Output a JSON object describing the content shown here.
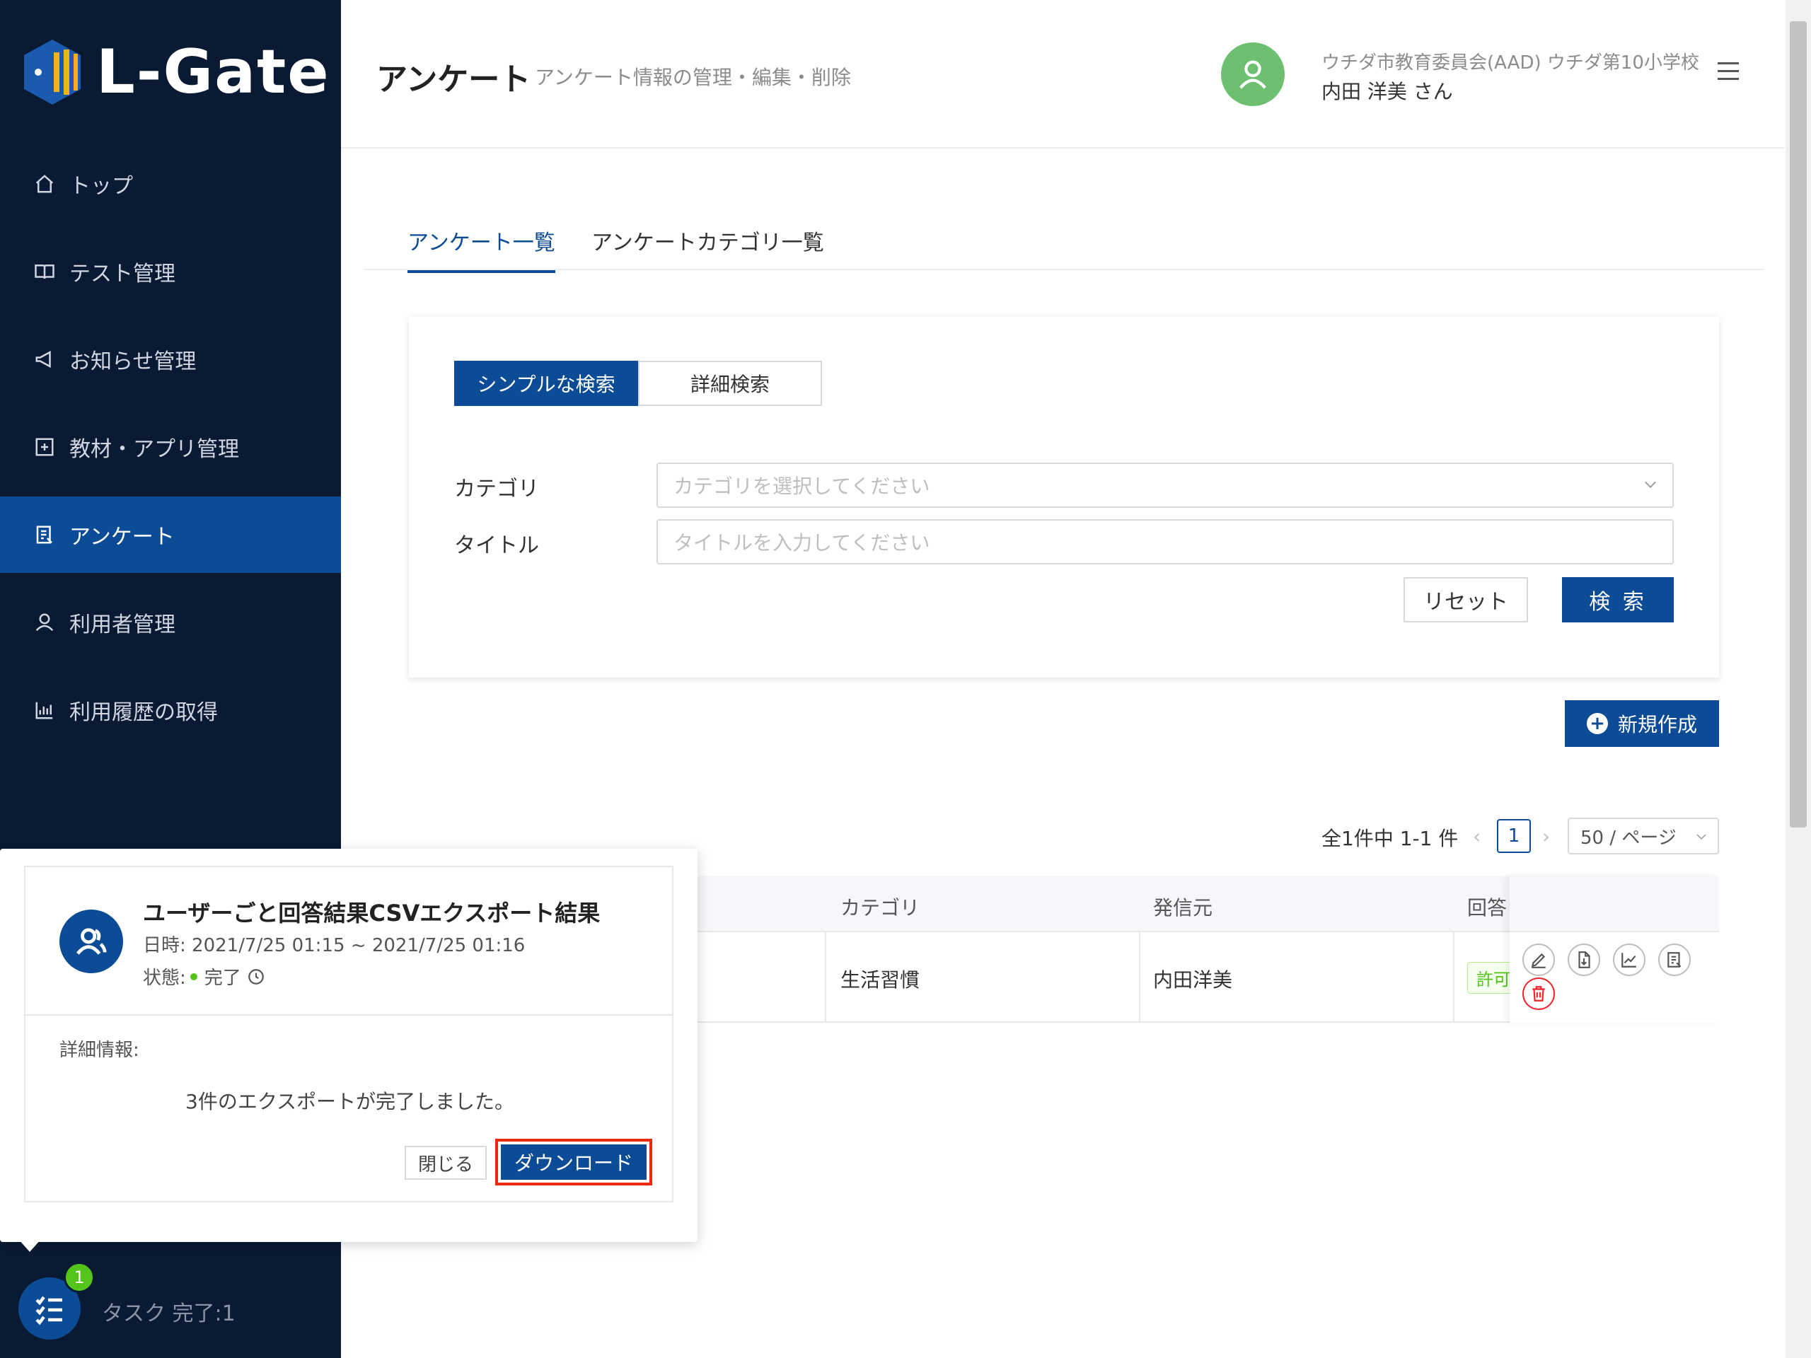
{
  "brand": {
    "name": "L-Gate"
  },
  "sidebar": {
    "items": [
      {
        "label": "トップ",
        "icon": "home-icon"
      },
      {
        "label": "テスト管理",
        "icon": "book-icon"
      },
      {
        "label": "お知らせ管理",
        "icon": "megaphone-icon"
      },
      {
        "label": "教材・アプリ管理",
        "icon": "plus-square-icon"
      },
      {
        "label": "アンケート",
        "icon": "survey-icon",
        "active": true
      },
      {
        "label": "利用者管理",
        "icon": "user-icon"
      },
      {
        "label": "利用履歴の取得",
        "icon": "bar-chart-icon"
      }
    ],
    "task": {
      "badge": "1",
      "label": "タスク 完了:1"
    }
  },
  "header": {
    "title": "アンケート",
    "subtitle": "アンケート情報の管理・編集・削除",
    "org": "ウチダ市教育委員会(AAD)   ウチダ第10小学校",
    "user": "内田 洋美 さん"
  },
  "tabs": [
    {
      "label": "アンケート一覧",
      "active": true
    },
    {
      "label": "アンケートカテゴリ一覧"
    }
  ],
  "search": {
    "mode_simple": "シンプルな検索",
    "mode_detail": "詳細検索",
    "category_label": "カテゴリ",
    "category_placeholder": "カテゴリを選択してください",
    "title_label": "タイトル",
    "title_placeholder": "タイトルを入力してください",
    "reset": "リセット",
    "submit": "検 索"
  },
  "new_button": "新規作成",
  "pagination": {
    "total": "全1件中 1-1 件",
    "current": "1",
    "page_size": "50 / ページ"
  },
  "table": {
    "headers": {
      "category": "カテゴリ",
      "sender": "発信元",
      "answer": "回答"
    },
    "rows": [
      {
        "category": "生活習慣",
        "sender": "内田洋美",
        "answer": "許可"
      }
    ]
  },
  "notification": {
    "title": "ユーザーごと回答結果CSVエクスポート結果",
    "date": "日時: 2021/7/25 01:15 ~ 2021/7/25 01:16",
    "status_label": "状態:",
    "status_value": "完了",
    "detail_label": "詳細情報:",
    "message": "3件のエクスポートが完了しました。",
    "close": "閉じる",
    "download": "ダウンロード"
  },
  "colors": {
    "primary": "#0c4b95",
    "sidebar": "#0a1a33",
    "success": "#52c41a",
    "danger": "#f5222d",
    "highlight": "#e8290b"
  }
}
